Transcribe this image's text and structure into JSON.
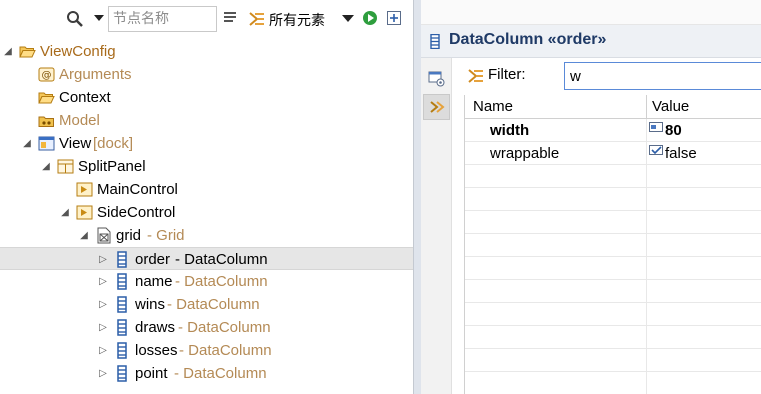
{
  "toolbar": {
    "search_placeholder": "节点名称",
    "filter_label": "所有元素"
  },
  "tree": {
    "nodes": [
      {
        "label": "ViewConfig",
        "suffix": "",
        "expanded": true
      },
      {
        "label": "Arguments",
        "suffix": ""
      },
      {
        "label": "Context",
        "suffix": ""
      },
      {
        "label": "Model",
        "suffix": ""
      },
      {
        "label": "View",
        "suffix": " [dock]",
        "expanded": true
      },
      {
        "label": "SplitPanel",
        "suffix": "",
        "expanded": true
      },
      {
        "label": "MainControl",
        "suffix": ""
      },
      {
        "label": "SideControl",
        "suffix": "",
        "expanded": true
      },
      {
        "label": "grid",
        "suffix": " - Grid",
        "expanded": true
      },
      {
        "label": "order",
        "suffix": " - DataColumn",
        "selected": true
      },
      {
        "label": "name",
        "suffix": " - DataColumn"
      },
      {
        "label": "wins",
        "suffix": " - DataColumn"
      },
      {
        "label": "draws",
        "suffix": " - DataColumn"
      },
      {
        "label": "losses",
        "suffix": " - DataColumn"
      },
      {
        "label": "point",
        "suffix": " - DataColumn"
      }
    ]
  },
  "properties": {
    "title": "DataColumn «order»",
    "filter_label": "Filter:",
    "filter_value": "w",
    "col_name": "Name",
    "col_value": "Value",
    "rows": [
      {
        "name": "width",
        "value": "80",
        "bold": true,
        "value_icon": "number-field-icon"
      },
      {
        "name": "wrappable",
        "value": "false",
        "bold": false,
        "value_icon": "checkbox-field-icon"
      }
    ]
  },
  "colors": {
    "title_blue": "#1f3a66",
    "tree_orange": "#a86a1a",
    "tree_tan": "#b48a55",
    "filter_focus": "#5a8ad8"
  }
}
